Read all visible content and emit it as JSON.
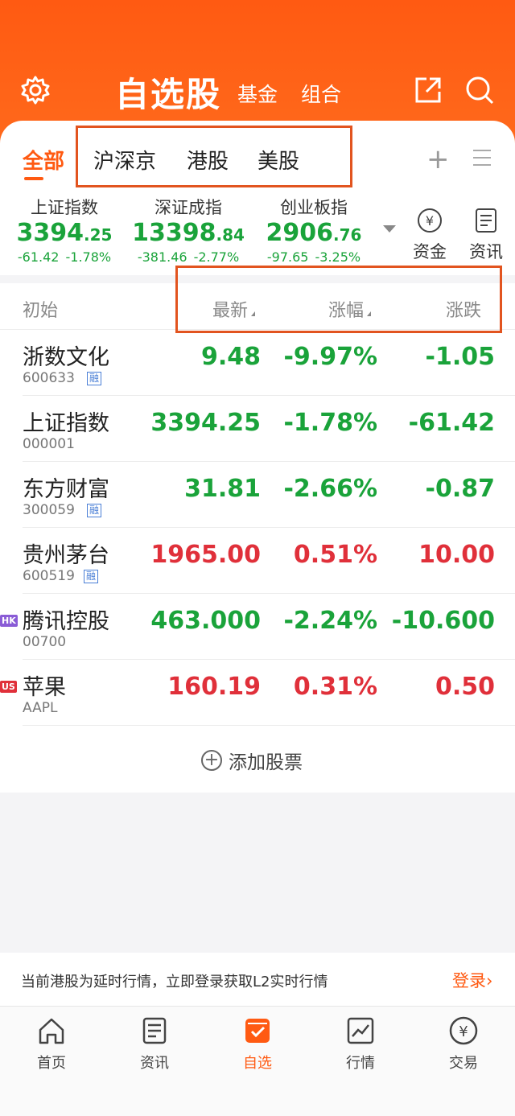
{
  "header": {
    "title": "自选股",
    "subtabs": [
      "基金",
      "组合"
    ]
  },
  "tabs": [
    "全部",
    "沪深京",
    "港股",
    "美股"
  ],
  "indices": [
    {
      "name": "上证指数",
      "int": "3394",
      "dec": ".25",
      "chg": "-61.42",
      "pct": "-1.78%"
    },
    {
      "name": "深证成指",
      "int": "13398",
      "dec": ".84",
      "chg": "-381.46",
      "pct": "-2.77%"
    },
    {
      "name": "创业板指",
      "int": "2906",
      "dec": ".76",
      "chg": "-97.65",
      "pct": "-3.25%"
    }
  ],
  "quick": [
    {
      "label": "资金",
      "icon": "yen-cycle-icon"
    },
    {
      "label": "资讯",
      "icon": "news-icon"
    }
  ],
  "columns": {
    "name": "初始",
    "latest": "最新",
    "pct": "涨幅",
    "chg": "涨跌"
  },
  "stocks": [
    {
      "name": "浙数文化",
      "code": "600633",
      "tag": "融",
      "market": "",
      "price": "9.48",
      "pct": "-9.97%",
      "chg": "-1.05",
      "dir": "down"
    },
    {
      "name": "上证指数",
      "code": "000001",
      "tag": "",
      "market": "",
      "price": "3394.25",
      "pct": "-1.78%",
      "chg": "-61.42",
      "dir": "down"
    },
    {
      "name": "东方财富",
      "code": "300059",
      "tag": "融",
      "market": "",
      "price": "31.81",
      "pct": "-2.66%",
      "chg": "-0.87",
      "dir": "down"
    },
    {
      "name": "贵州茅台",
      "code": "600519",
      "tag": "融",
      "market": "",
      "price": "1965.00",
      "pct": "0.51%",
      "chg": "10.00",
      "dir": "up"
    },
    {
      "name": "腾讯控股",
      "code": "00700",
      "tag": "",
      "market": "HK",
      "price": "463.000",
      "pct": "-2.24%",
      "chg": "-10.600",
      "dir": "down"
    },
    {
      "name": "苹果",
      "code": "AAPL",
      "tag": "",
      "market": "US",
      "price": "160.19",
      "pct": "0.31%",
      "chg": "0.50",
      "dir": "up"
    }
  ],
  "add_stock": "添加股票",
  "notice": {
    "text": "当前港股为延时行情，立即登录获取L2实时行情",
    "login": "登录"
  },
  "nav": [
    {
      "label": "首页",
      "icon": "home-icon"
    },
    {
      "label": "资讯",
      "icon": "news-icon"
    },
    {
      "label": "自选",
      "icon": "watchlist-icon"
    },
    {
      "label": "行情",
      "icon": "chart-icon"
    },
    {
      "label": "交易",
      "icon": "yen-icon"
    }
  ],
  "colors": {
    "accent": "#ff5a12",
    "up": "#e0303a",
    "down": "#1aa33a"
  }
}
